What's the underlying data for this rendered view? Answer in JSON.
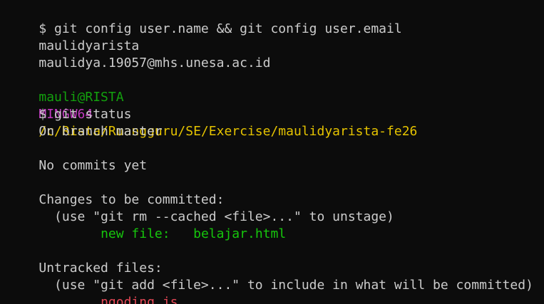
{
  "colors": {
    "background": "#0c0c0c",
    "text": "#cccccc",
    "prompt_user": "#13a10e",
    "prompt_mingw": "#c239c1",
    "prompt_path": "#e5c300",
    "staged_file": "#16c60c",
    "untracked_file": "#e74856"
  },
  "lines": {
    "l1": "$ git config user.name && git config user.email",
    "l2": "maulidyarista",
    "l3": "maulidya.19057@mhs.unesa.ac.id",
    "prompt_user": "mauli@RISTA",
    "prompt_env": "MINGW64",
    "prompt_path": "/c/Rista/Ruangguru/SE/Exercise/maulidyarista-fe26",
    "l5": "$ git status",
    "l6": "On branch master",
    "l8": "No commits yet",
    "l10": "Changes to be committed:",
    "l11": "  (use \"git rm --cached <file>...\" to unstage)",
    "l12_label": "new file:",
    "l12_file": "belajar.html",
    "l14": "Untracked files:",
    "l15": "  (use \"git add <file>...\" to include in what will be committed)",
    "l16_file": "ngoding.js"
  }
}
